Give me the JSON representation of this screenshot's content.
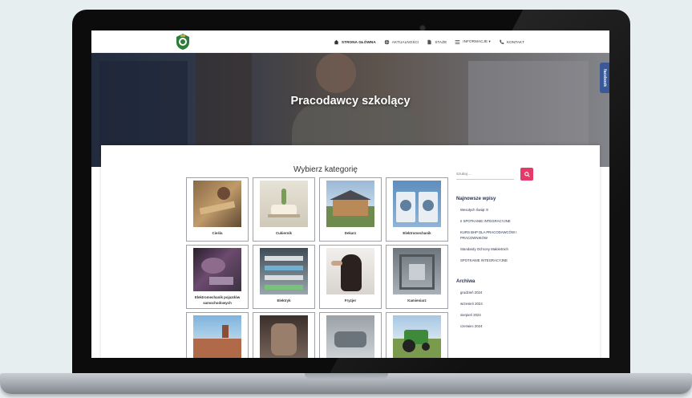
{
  "nav": {
    "items": [
      {
        "label": "Strona główna",
        "icon": "home-icon",
        "active": true
      },
      {
        "label": "Aktualności",
        "icon": "globe-icon",
        "active": false
      },
      {
        "label": "Staże",
        "icon": "file-icon",
        "active": false
      },
      {
        "label": "Informacje ▾",
        "icon": "list-icon",
        "active": false
      },
      {
        "label": "Kontakt",
        "icon": "phone-icon",
        "active": false
      }
    ]
  },
  "hero": {
    "title": "Pracodawcy szkolący"
  },
  "facebook_tab": {
    "label": "facebook"
  },
  "main": {
    "section_title": "Wybierz kategorię",
    "categories": [
      {
        "label": "Cieśla",
        "icon": "carpentry-photo"
      },
      {
        "label": "Cukiernik",
        "icon": "cake-photo"
      },
      {
        "label": "Dekarz",
        "icon": "house-photo"
      },
      {
        "label": "Elektromechanik",
        "icon": "washing-machines-photo"
      },
      {
        "label": "Elektromechanik pojazdów samochodowych",
        "icon": "car-parts-photo"
      },
      {
        "label": "Elektryk",
        "icon": "electrical-panel-photo"
      },
      {
        "label": "Fryzjer",
        "icon": "hair-photo"
      },
      {
        "label": "Kamieniarz",
        "icon": "stone-photo"
      },
      {
        "label": "",
        "icon": "roof-photo"
      },
      {
        "label": "",
        "icon": "tattoo-photo"
      },
      {
        "label": "",
        "icon": "metal-photo"
      },
      {
        "label": "",
        "icon": "tractor-photo"
      }
    ]
  },
  "sidebar": {
    "search_placeholder": "Szukaj ...",
    "recent_title": "Najnowsze wpisy",
    "recent_posts": [
      "Wesołych Świąt !!!",
      "II SPOTKANIE INTEGRACYJNE",
      "KURS BHP DLA PRACODAWCÓW I PRACOWNIKÓW",
      "Standardy Ochrony Małoletnich",
      "SPOTKANIE INTEGRACYJNE"
    ],
    "archive_title": "Archiwa",
    "archive_items": [
      "grudzień 2024",
      "wrzesień 2024",
      "sierpień 2024",
      "czerwiec 2024"
    ]
  },
  "colors": {
    "accent": "#e43a68",
    "heading": "#2b3350",
    "facebook": "#3b5998"
  }
}
